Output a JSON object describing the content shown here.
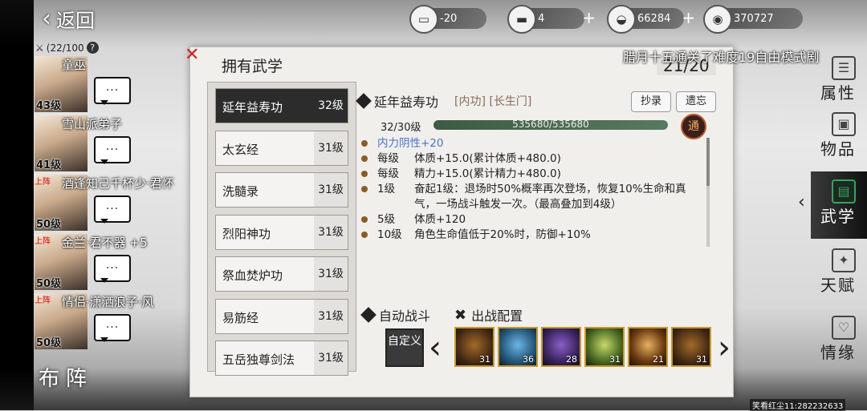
{
  "nav": {
    "back_label": "返回"
  },
  "resources": [
    {
      "icon": "chest-icon",
      "glyph": "▭",
      "value": "-20"
    },
    {
      "icon": "gold-bar-icon",
      "glyph": "▬",
      "value": "4"
    },
    {
      "icon": "silver-ingot-icon",
      "glyph": "◒",
      "value": "66284"
    },
    {
      "icon": "coin-icon",
      "glyph": "◉",
      "value": "370727"
    }
  ],
  "roster": {
    "count": "(22/100",
    "help": "?",
    "heroes": [
      {
        "name": "童巫",
        "level": "43级",
        "tag": "",
        "bubble": "···"
      },
      {
        "name": "雪山派弟子",
        "level": "41级",
        "tag": "",
        "bubble": "···"
      },
      {
        "name": "酒逢知己千杯少·君怀",
        "level": "50级",
        "tag": "上阵",
        "bubble": "···"
      },
      {
        "name": "金兰·君不器 +5",
        "level": "50级",
        "tag": "上阵",
        "bubble": "···"
      },
      {
        "name": "情侣·潇洒浪子·风",
        "level": "50级",
        "tag": "上阵",
        "bubble": "···"
      }
    ],
    "formation_label": "布阵"
  },
  "panel": {
    "title": "拥有武学",
    "count": "21/20",
    "notice": "腊月十五通关了难度19自由模式剧"
  },
  "skills": [
    {
      "name": "延年益寿功",
      "level": "32级",
      "active": true
    },
    {
      "name": "太玄经",
      "level": "31级"
    },
    {
      "name": "洗髓录",
      "level": "31级"
    },
    {
      "name": "烈阳神功",
      "level": "31级"
    },
    {
      "name": "祭血焚炉功",
      "level": "31级"
    },
    {
      "name": "易筋经",
      "level": "31级"
    },
    {
      "name": "五岳独尊剑法",
      "level": "31级"
    }
  ],
  "detail": {
    "name": "延年益寿功",
    "tags": "[内功] [长生门]",
    "copy_label": "抄录",
    "forget_label": "遗忘",
    "level_text": "32/30级",
    "exp_text": "535680/535680",
    "exp_fraction": 1.0,
    "badge": "通",
    "attrs": [
      {
        "k": "",
        "v": "内力阴性+20",
        "blue": true
      },
      {
        "k": "每级",
        "v": "体质+15.0(累计体质+480.0)"
      },
      {
        "k": "每级",
        "v": "精力+15.0(累计精力+480.0)"
      },
      {
        "k": "1级",
        "v": "奋起1级：退场时50%概率再次登场，恢复10%生命和真气，一场战斗触发一次。（最高叠加到4级）"
      },
      {
        "k": "5级",
        "v": "体质+120"
      },
      {
        "k": "10级",
        "v": "角色生命值低于20%时，防御+10%"
      }
    ],
    "auto_battle_label": "自动战斗",
    "battle_config_label": "出战配置",
    "custom_label": "自定义"
  },
  "loadout": [
    {
      "style": "",
      "count": "31"
    },
    {
      "style": "blue",
      "count": "36"
    },
    {
      "style": "purple",
      "count": "28"
    },
    {
      "style": "green",
      "count": "31"
    },
    {
      "style": "fire",
      "count": "21"
    },
    {
      "style": "",
      "count": "31"
    }
  ],
  "menu": [
    {
      "label": "属性",
      "icon": "attribute-icon",
      "glyph": "☰"
    },
    {
      "label": "物品",
      "icon": "item-box-icon",
      "glyph": "▣"
    },
    {
      "label": "武学",
      "icon": "martial-book-icon",
      "glyph": "▤",
      "active": true
    },
    {
      "label": "天赋",
      "icon": "talent-icon",
      "glyph": "✦"
    },
    {
      "label": "情缘",
      "icon": "heart-icon",
      "glyph": "♡"
    }
  ],
  "footer": "笑看红尘11:282232633"
}
